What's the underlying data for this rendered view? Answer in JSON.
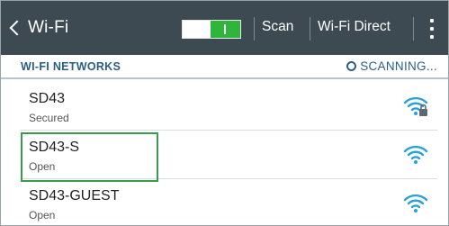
{
  "appbar": {
    "title": "Wi-Fi",
    "wifi_toggle_state": "on",
    "scan_label": "Scan",
    "wifi_direct_label": "Wi-Fi Direct",
    "icons": {
      "back": "chevron-left-icon",
      "overflow": "more-vertical-icon"
    }
  },
  "section": {
    "title": "WI-FI NETWORKS",
    "scanning_label": "SCANNING..."
  },
  "networks": [
    {
      "ssid": "SD43",
      "status": "Secured",
      "icon": "wifi-lock-icon",
      "locked": true
    },
    {
      "ssid": "SD43-S",
      "status": "Open",
      "icon": "wifi-icon",
      "locked": false,
      "highlighted": true
    },
    {
      "ssid": "SD43-GUEST",
      "status": "Open",
      "icon": "wifi-icon",
      "locked": false
    }
  ],
  "colors": {
    "appbar_bg": "#3d4a52",
    "accent_text": "#2b5f87",
    "toggle_on": "#2fb43c",
    "wifi_icon": "#2aa1d8",
    "highlight_border": "#3a9a4c"
  }
}
